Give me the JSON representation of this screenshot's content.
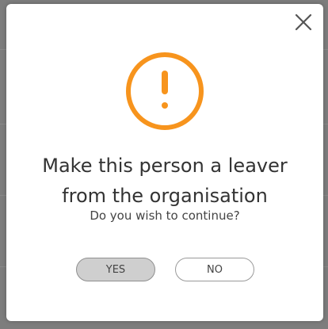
{
  "dialog": {
    "title_line1": "Make this person a leaver",
    "title_line2": "from the organisation",
    "question": "Do you wish to continue?",
    "yes_label": "YES",
    "no_label": "NO",
    "close_icon": "close-icon",
    "warning_icon": "exclamation-circle-icon"
  },
  "colors": {
    "warning": "#f7941d",
    "backdrop": "#7d7d7d",
    "yes_button": "#cfcfcf"
  }
}
